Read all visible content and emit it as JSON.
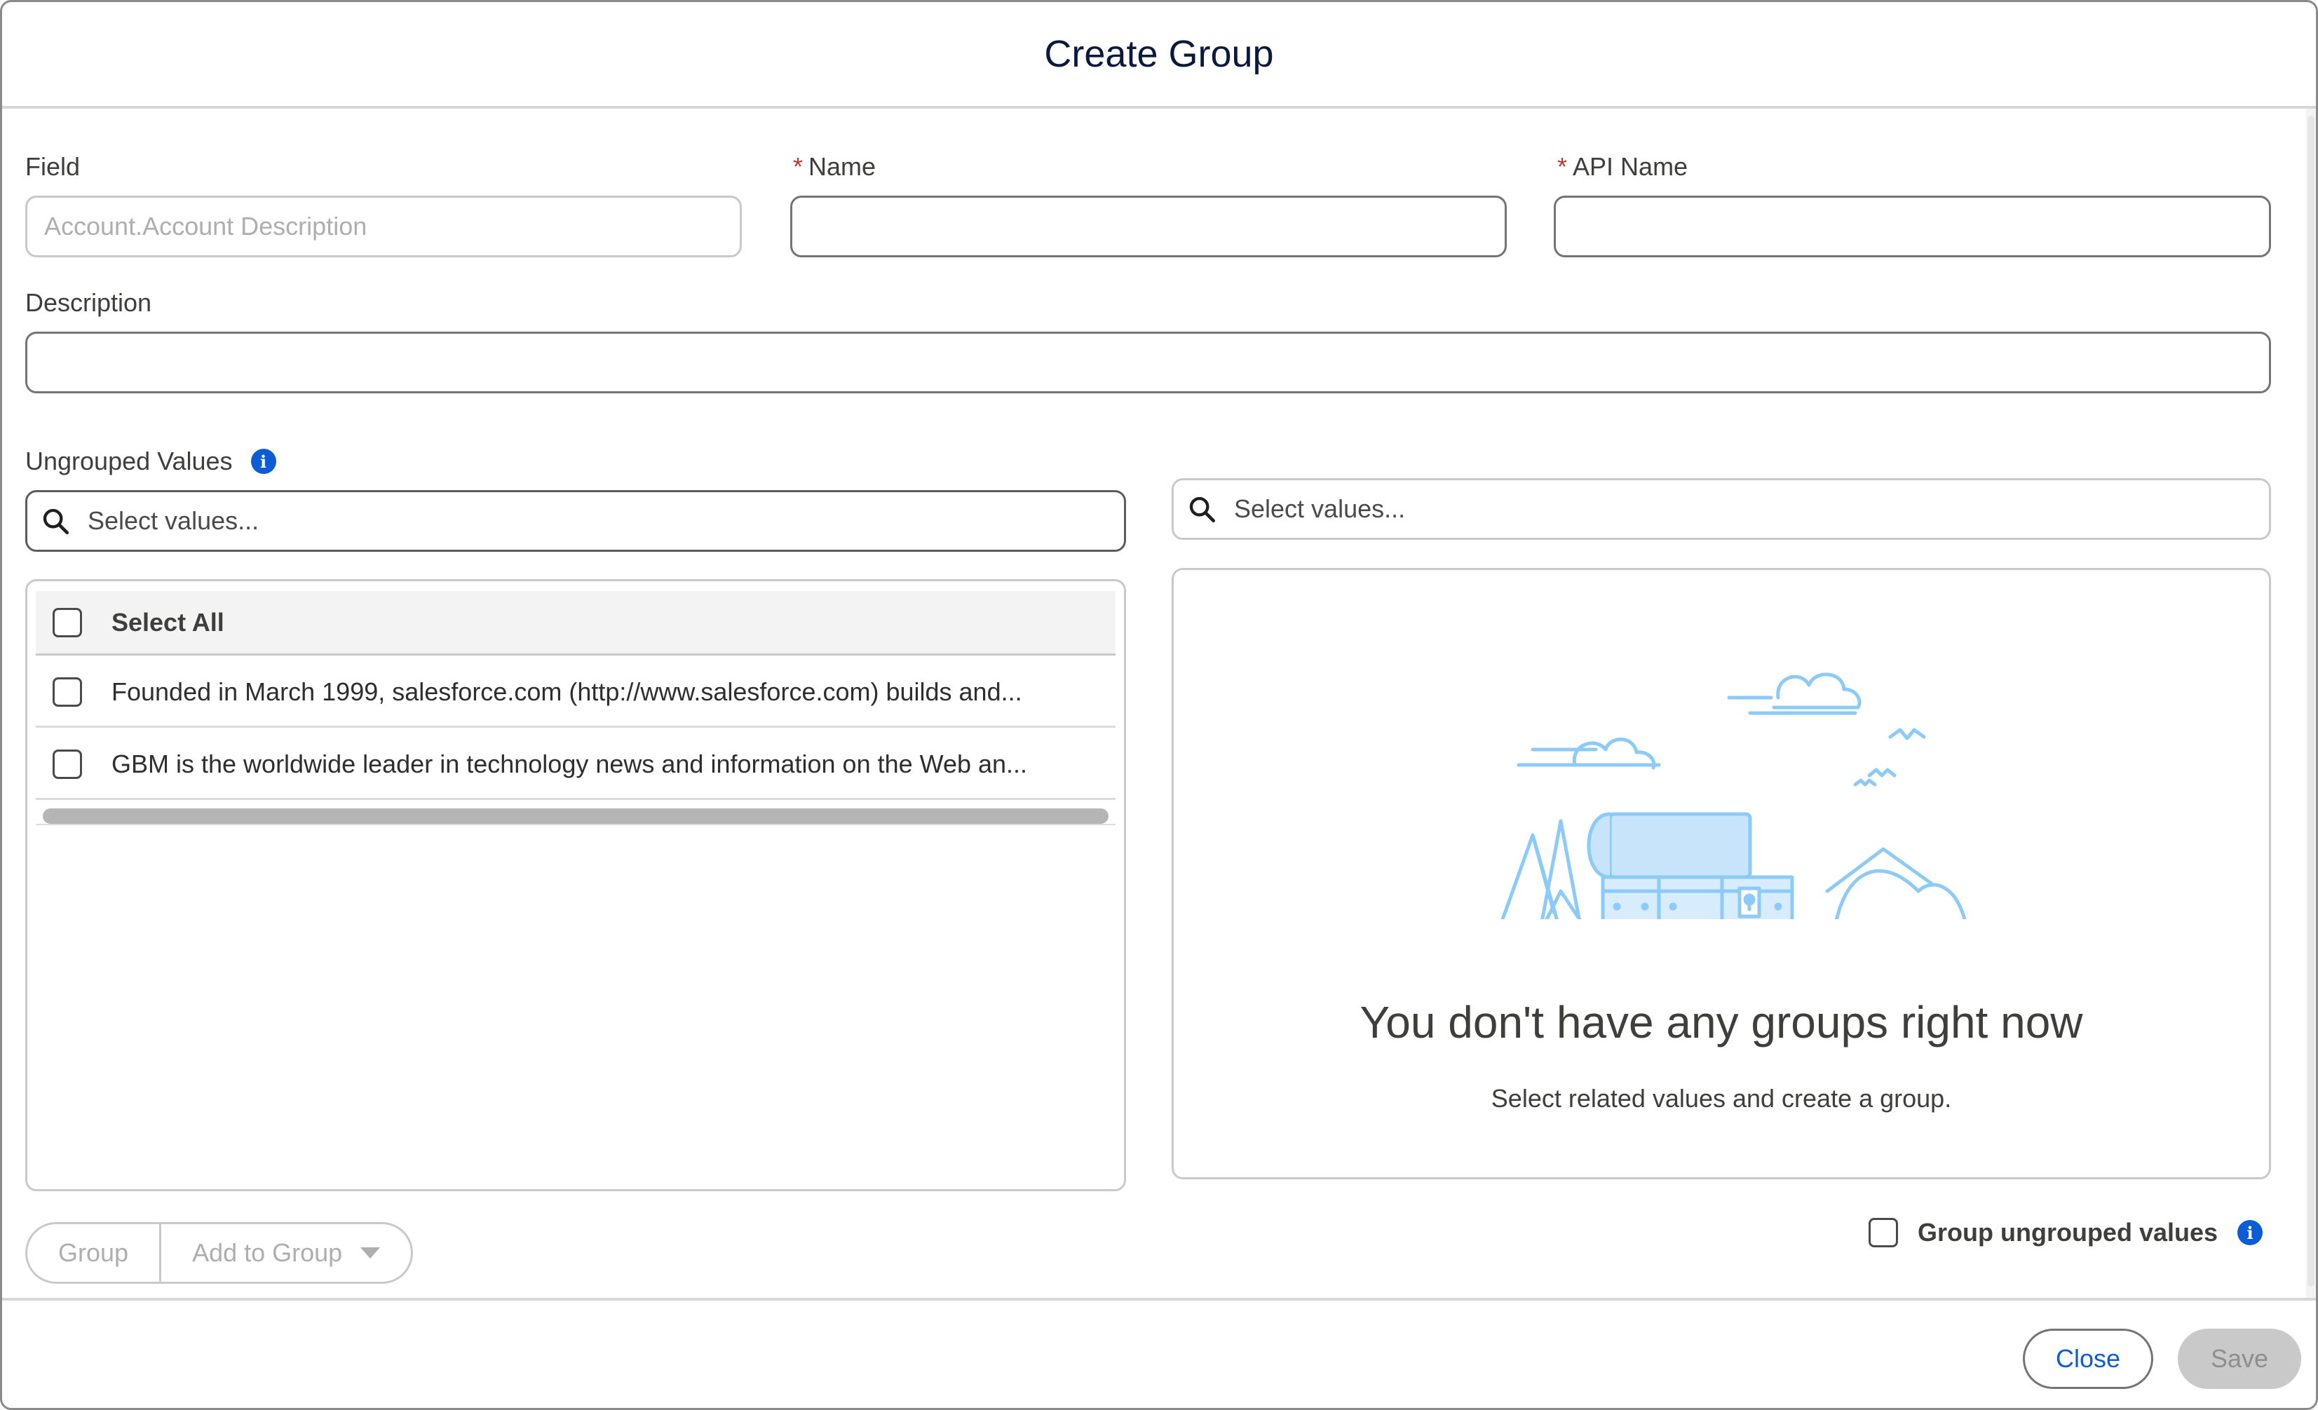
{
  "modal": {
    "title": "Create Group"
  },
  "form": {
    "field_label": "Field",
    "field_placeholder": "Account.Account Description",
    "name_required_mark": "*",
    "name_label": "Name",
    "name_value": "",
    "api_name_required_mark": "*",
    "api_name_label": "API Name",
    "api_name_value": "",
    "description_label": "Description",
    "description_value": ""
  },
  "ungrouped": {
    "label": "Ungrouped Values",
    "info_icon": "info-icon",
    "search_placeholder": "Select values...",
    "select_all_label": "Select All",
    "rows": [
      {
        "text": "Founded in March 1999, salesforce.com (http://www.salesforce.com) builds and..."
      },
      {
        "text": "GBM is the worldwide leader in technology news and information on the Web an..."
      }
    ]
  },
  "groups": {
    "search_placeholder": "Select values...",
    "empty_title": "You don't have any groups right now",
    "empty_subtitle": "Select related values and create a group."
  },
  "actions": {
    "group_label": "Group",
    "add_to_group_label": "Add to Group",
    "group_ungrouped_label": "Group ungrouped values"
  },
  "footer": {
    "close_label": "Close",
    "save_label": "Save"
  },
  "colors": {
    "accent": "#0b5cd5",
    "required": "#c23934",
    "illustration": "#8ccaf7"
  }
}
